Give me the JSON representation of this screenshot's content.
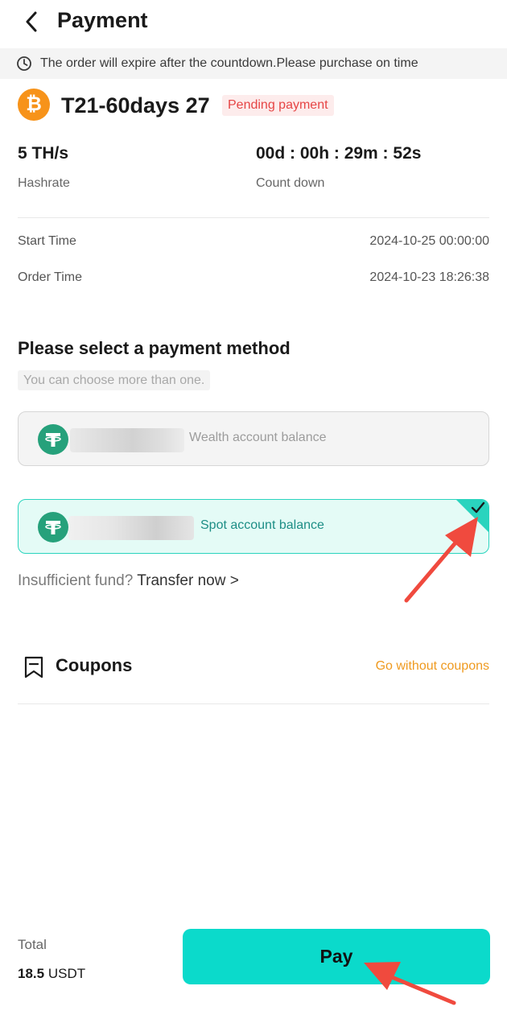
{
  "header": {
    "title": "Payment"
  },
  "banner": {
    "text": "The order will expire after the countdown.Please purchase on time",
    "icon": "clock-icon"
  },
  "product": {
    "icon": "bitcoin-icon",
    "icon_glyph": "₿",
    "name": "T21-60days 27",
    "status": "Pending payment"
  },
  "stats": {
    "hashrate_value": "5 TH/s",
    "hashrate_label": "Hashrate",
    "countdown_value": "00d : 00h : 29m : 52s",
    "countdown_label": "Count down"
  },
  "info": {
    "start_label": "Start Time",
    "start_value": "2024-10-25 00:00:00",
    "order_label": "Order Time",
    "order_value": "2024-10-23 18:26:38"
  },
  "payment": {
    "title": "Please select a payment method",
    "hint": "You can choose more than one.",
    "options": [
      {
        "label": "Wealth account balance",
        "selected": false,
        "icon": "tether-icon"
      },
      {
        "label": "Spot account balance",
        "selected": true,
        "icon": "tether-icon"
      }
    ],
    "insufficient_text": "Insufficient fund?",
    "transfer_link": "Transfer now >"
  },
  "coupons": {
    "title": "Coupons",
    "icon": "bookmark-icon",
    "link": "Go without coupons"
  },
  "footer": {
    "total_label": "Total",
    "total_amount": "18.5",
    "total_currency": "USDT",
    "pay_button": "Pay"
  },
  "colors": {
    "accent": "#0bdacb",
    "bitcoin": "#f7931a",
    "tether": "#26a17b",
    "status_red": "#e64545",
    "coupon_orange": "#ef9a1f",
    "annotation_red": "#f04a3e"
  }
}
